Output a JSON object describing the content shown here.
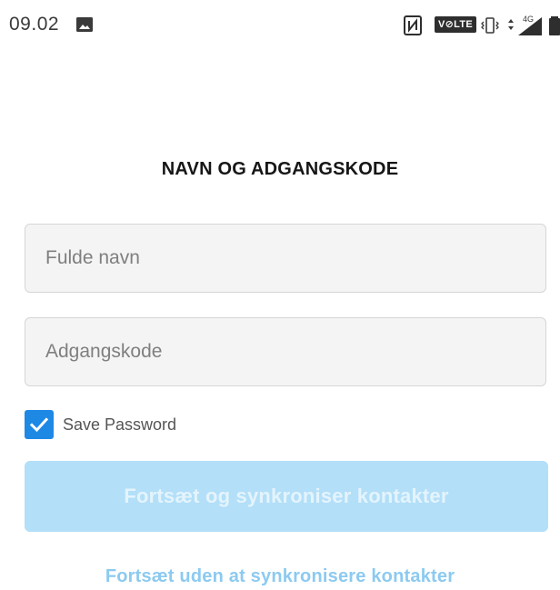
{
  "status_bar": {
    "time": "09.02",
    "volte": "V⊘LTE",
    "network": "4G",
    "icons": [
      "image-icon",
      "nfc-icon",
      "vibrate-icon",
      "signal-icon",
      "battery-icon"
    ]
  },
  "form": {
    "title": "NAVN OG ADGANGSKODE",
    "name_placeholder": "Fulde navn",
    "password_placeholder": "Adgangskode",
    "save_password_label": "Save Password",
    "save_password_checked": true,
    "primary_button_label": "Fortsæt og synkroniser kontakter",
    "primary_button_enabled": false,
    "secondary_link_label": "Fortsæt uden at synkronisere kontakter"
  },
  "colors": {
    "accent": "#1e88e5",
    "button_disabled": "#b3dff8",
    "link": "#8ccaf0"
  }
}
